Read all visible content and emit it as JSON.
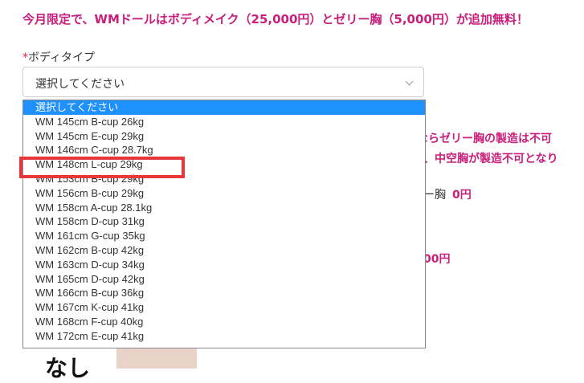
{
  "promo_text": "今月限定で、WMドールはボディメイク（25,000円）とゼリー胸（5,000円）が追加無料！",
  "field": {
    "required_mark": "*",
    "label": "ボディタイプ",
    "select_value": "選択してください"
  },
  "background_text": {
    "line1": "ならゼリー胸の製造は不可",
    "line2": "、中空胸が製造不可となり",
    "line3_label": "ー胸",
    "line3_price": "0円",
    "line4_price": "00円",
    "bottom_text": "なし"
  },
  "dropdown_options": [
    "選択してください",
    "WM 145cm B-cup 26kg",
    "WM 145cm E-cup 29kg",
    "WM 146cm C-cup 28.7kg",
    "WM 148cm L-cup 29kg",
    "WM 153cm B-cup 29kg",
    "WM 156cm B-cup 29kg",
    "WM 158cm A-cup 28.1kg",
    "WM 158cm D-cup 31kg",
    "WM 161cm G-cup 35kg",
    "WM 162cm B-cup 42kg",
    "WM 163cm D-cup 34kg",
    "WM 165cm D-cup 42kg",
    "WM 166cm B-cup 36kg",
    "WM 167cm K-cup 41kg",
    "WM 168cm F-cup 40kg",
    "WM 172cm E-cup 41kg"
  ],
  "selected_index": 0,
  "highlighted_option": "WM 148cm L-cup 29kg",
  "colors": {
    "accent": "#c81e7c",
    "selected_bg": "#1e90ff",
    "highlight_border": "#e8363b"
  }
}
